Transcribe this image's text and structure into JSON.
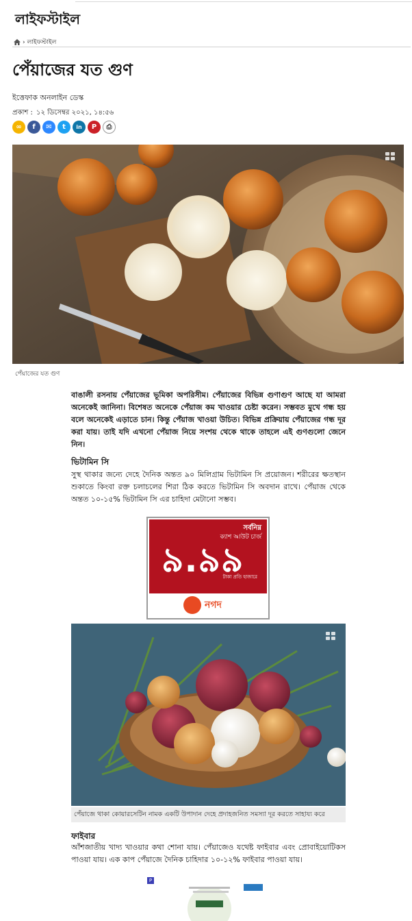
{
  "section": {
    "title": "লাইফস্টাইল"
  },
  "breadcrumb": {
    "home_icon": "home-icon",
    "separator": "›",
    "current": "লাইফস্টাইল"
  },
  "article": {
    "title": "পেঁয়াজের যত গুণ",
    "byline": "ইত্তেফাক অনলাইন ডেস্ক",
    "published_label": "প্রকাশ :",
    "published_value": "১২ ডিসেম্বর ২০২১, ১৪:৫৬",
    "lead": "বাঙালী রসনায় পেঁয়াজের ভূমিকা অপরিসীম। পেঁয়াজের বিভিন্ন গুণাগুণ আছে যা আমরা অনেকেই জানিনা। বিশেষত অনেকে পেঁয়াজ কম খাওয়ার চেষ্টা করেন। সম্ভবত মুখে গন্ধ হয় বলে অনেকেই এড়াতে চান। কিন্তু পেঁয়াজ খাওয়া উচিত। বিভিন্ন প্রক্রিয়ায় পেঁয়াজের গন্ধ দূর করা যায়। তাই যদি এখনো পেঁয়াজ নিয়ে সংশয় থেকে থাকে তাহলে এই গুণগুলো জেনে নিন।",
    "hero_caption": "পেঁয়াজের যত গুণ",
    "sections": [
      {
        "heading": "ভিটামিন সি",
        "text": "সুস্থ থাকার জন্যে দেহে দৈনিক অন্তত ৯০ মিলিগ্রাম ভিটামিন সি প্রয়োজন। শরীরের ক্ষতস্থান শুকাতে কিংবা রক্ত চলাচলের শিরা ঠিক করতে ভিটামিন সি অবদান রাখে। পেঁয়াজ থেকে অন্তত ১০-১৫% ভিটামিন সি এর চাহিদা মেটানো সম্ভব।"
      },
      {
        "heading": "ফাইবার",
        "text": "আঁশজাতীয় খাদ্য খাওয়ার কথা শোনা যায়। পেঁয়াজেও যথেষ্ট ফাইবার এবং প্রোবাইয়োটিকস পাওয়া যায়। এক কাপ পেঁয়াজে দৈনিক চাহিদার ১০-১২% ফাইবার পাওয়া যায়।"
      }
    ],
    "image2_caption": "পেঁয়াজে থাকা কোয়ারসেটিন নামক একটি উপাদান দেহে প্রদাহজনিত সমস্যা দূর করতে সাহায্য করে"
  },
  "share_buttons": [
    {
      "icon": "link-icon",
      "glyph": "∞",
      "color": "#f5b400"
    },
    {
      "icon": "facebook-icon",
      "glyph": "f",
      "color": "#3b5998"
    },
    {
      "icon": "messenger-icon",
      "glyph": "✉",
      "color": "#2d88ff"
    },
    {
      "icon": "twitter-icon",
      "glyph": "t",
      "color": "#1da1f2"
    },
    {
      "icon": "linkedin-icon",
      "glyph": "in",
      "color": "#0e76a8"
    },
    {
      "icon": "pinterest-icon",
      "glyph": "P",
      "color": "#cb2027"
    },
    {
      "icon": "print-icon",
      "glyph": "⎙",
      "color": "#333333"
    }
  ],
  "ad1": {
    "line1": "সর্বনিম্ন",
    "line2": "ক্যাশ আউট চার্জ",
    "big": "৯.৯৯",
    "line3": "টাকা প্রতি হাজারে",
    "brand": "নগদ"
  },
  "ad2": {
    "marker": "P"
  }
}
